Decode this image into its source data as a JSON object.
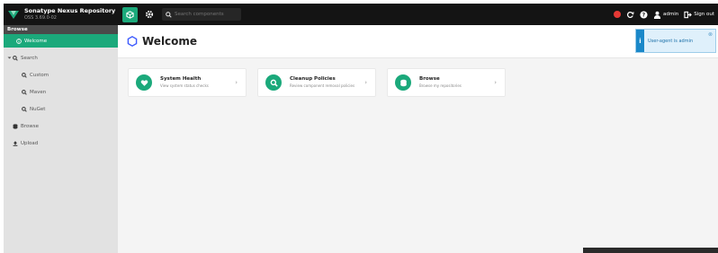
{
  "header": {
    "brand_title": "Sonatype Nexus Repository",
    "brand_version": "OSS 3.69.0-02",
    "search_placeholder": "Search components",
    "user_label": "admin",
    "signout_label": "Sign out"
  },
  "sidebar": {
    "section_title": "Browse",
    "items": [
      {
        "label": "Welcome",
        "icon": "info-circle-icon"
      },
      {
        "label": "Search",
        "icon": "search-icon"
      },
      {
        "label": "Custom",
        "icon": "search-icon"
      },
      {
        "label": "Maven",
        "icon": "search-icon"
      },
      {
        "label": "NuGet",
        "icon": "search-icon"
      },
      {
        "label": "Browse",
        "icon": "database-icon"
      },
      {
        "label": "Upload",
        "icon": "upload-icon"
      }
    ]
  },
  "main": {
    "title": "Welcome",
    "banner_text": "User-agent is admin",
    "cards": [
      {
        "title": "System Health",
        "desc": "View system status checks"
      },
      {
        "title": "Cleanup Policies",
        "desc": "Review component removal policies"
      },
      {
        "title": "Browse",
        "desc": "Browse my repositories"
      }
    ]
  },
  "colors": {
    "accent": "#1ba97b",
    "topbar": "#141414",
    "sidebar_bg": "#e2e2e2",
    "banner_bg": "#dff0fb",
    "alert": "#e53935"
  }
}
